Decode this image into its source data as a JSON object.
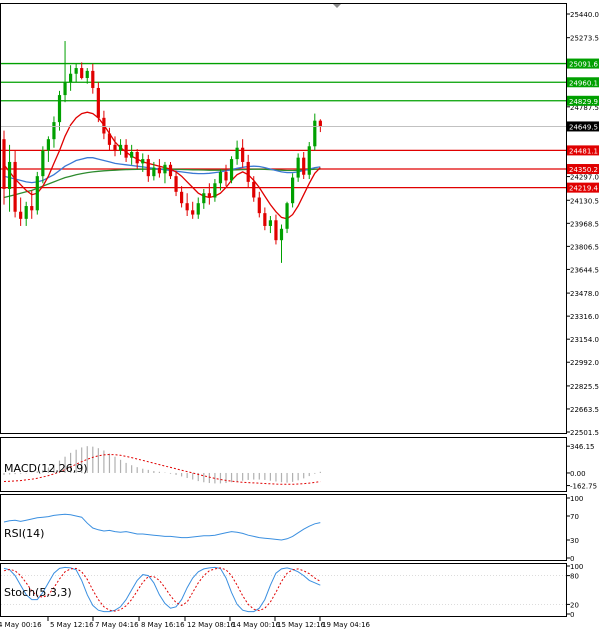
{
  "chart_data": {
    "type": "candlestick",
    "panels": {
      "main": {
        "y_ticks": [
          "25440.0",
          "25273.5",
          "24787.5",
          "24297.0",
          "24130.5",
          "23968.5",
          "23806.5",
          "23644.5",
          "23478.0",
          "23316.0",
          "23154.0",
          "22992.0",
          "22825.5",
          "22663.5",
          "22501.5"
        ],
        "ylim": [
          22501.5,
          25440.0
        ],
        "candles": [
          {
            "o": 24560,
            "h": 24620,
            "l": 24100,
            "c": 24210
          },
          {
            "o": 24210,
            "h": 24520,
            "l": 24050,
            "c": 24400
          },
          {
            "o": 24400,
            "h": 24480,
            "l": 24010,
            "c": 24050
          },
          {
            "o": 24050,
            "h": 24150,
            "l": 23950,
            "c": 24000
          },
          {
            "o": 24000,
            "h": 24120,
            "l": 23950,
            "c": 24090
          },
          {
            "o": 24090,
            "h": 24200,
            "l": 24000,
            "c": 24060
          },
          {
            "o": 24060,
            "h": 24330,
            "l": 24030,
            "c": 24300
          },
          {
            "o": 24300,
            "h": 24510,
            "l": 24250,
            "c": 24480
          },
          {
            "o": 24480,
            "h": 24580,
            "l": 24400,
            "c": 24560
          },
          {
            "o": 24560,
            "h": 24720,
            "l": 24500,
            "c": 24680
          },
          {
            "o": 24680,
            "h": 24900,
            "l": 24620,
            "c": 24870
          },
          {
            "o": 24870,
            "h": 25250,
            "l": 24820,
            "c": 24960
          },
          {
            "o": 24960,
            "h": 25080,
            "l": 24900,
            "c": 25020
          },
          {
            "o": 25020,
            "h": 25090,
            "l": 24960,
            "c": 25060
          },
          {
            "o": 25060,
            "h": 25100,
            "l": 24980,
            "c": 24990
          },
          {
            "o": 24990,
            "h": 25060,
            "l": 24950,
            "c": 25040
          },
          {
            "o": 25040,
            "h": 25090,
            "l": 24880,
            "c": 24920
          },
          {
            "o": 24920,
            "h": 24960,
            "l": 24680,
            "c": 24710
          },
          {
            "o": 24710,
            "h": 24760,
            "l": 24560,
            "c": 24600
          },
          {
            "o": 24600,
            "h": 24640,
            "l": 24480,
            "c": 24520
          },
          {
            "o": 24520,
            "h": 24580,
            "l": 24440,
            "c": 24480
          },
          {
            "o": 24480,
            "h": 24560,
            "l": 24450,
            "c": 24520
          },
          {
            "o": 24520,
            "h": 24560,
            "l": 24400,
            "c": 24430
          },
          {
            "o": 24430,
            "h": 24520,
            "l": 24380,
            "c": 24470
          },
          {
            "o": 24470,
            "h": 24490,
            "l": 24350,
            "c": 24390
          },
          {
            "o": 24390,
            "h": 24460,
            "l": 24330,
            "c": 24420
          },
          {
            "o": 24420,
            "h": 24450,
            "l": 24260,
            "c": 24300
          },
          {
            "o": 24300,
            "h": 24400,
            "l": 24270,
            "c": 24360
          },
          {
            "o": 24360,
            "h": 24420,
            "l": 24290,
            "c": 24320
          },
          {
            "o": 24320,
            "h": 24400,
            "l": 24250,
            "c": 24380
          },
          {
            "o": 24380,
            "h": 24400,
            "l": 24280,
            "c": 24300
          },
          {
            "o": 24300,
            "h": 24340,
            "l": 24160,
            "c": 24190
          },
          {
            "o": 24190,
            "h": 24230,
            "l": 24080,
            "c": 24110
          },
          {
            "o": 24110,
            "h": 24180,
            "l": 24020,
            "c": 24060
          },
          {
            "o": 24060,
            "h": 24120,
            "l": 24000,
            "c": 24030
          },
          {
            "o": 24030,
            "h": 24150,
            "l": 24000,
            "c": 24110
          },
          {
            "o": 24110,
            "h": 24210,
            "l": 24070,
            "c": 24180
          },
          {
            "o": 24180,
            "h": 24250,
            "l": 24100,
            "c": 24150
          },
          {
            "o": 24150,
            "h": 24280,
            "l": 24120,
            "c": 24250
          },
          {
            "o": 24250,
            "h": 24350,
            "l": 24200,
            "c": 24330
          },
          {
            "o": 24330,
            "h": 24380,
            "l": 24230,
            "c": 24270
          },
          {
            "o": 24270,
            "h": 24440,
            "l": 24250,
            "c": 24420
          },
          {
            "o": 24420,
            "h": 24550,
            "l": 24380,
            "c": 24500
          },
          {
            "o": 24500,
            "h": 24560,
            "l": 24360,
            "c": 24400
          },
          {
            "o": 24400,
            "h": 24450,
            "l": 24220,
            "c": 24260
          },
          {
            "o": 24260,
            "h": 24300,
            "l": 24120,
            "c": 24150
          },
          {
            "o": 24150,
            "h": 24190,
            "l": 24010,
            "c": 24040
          },
          {
            "o": 24040,
            "h": 24080,
            "l": 23920,
            "c": 23950
          },
          {
            "o": 23950,
            "h": 24020,
            "l": 23900,
            "c": 23990
          },
          {
            "o": 23990,
            "h": 24030,
            "l": 23820,
            "c": 23850
          },
          {
            "o": 23850,
            "h": 23960,
            "l": 23690,
            "c": 23930
          },
          {
            "o": 23930,
            "h": 24120,
            "l": 23900,
            "c": 24110
          },
          {
            "o": 24110,
            "h": 24320,
            "l": 24080,
            "c": 24290
          },
          {
            "o": 24290,
            "h": 24460,
            "l": 24260,
            "c": 24430
          },
          {
            "o": 24430,
            "h": 24470,
            "l": 24280,
            "c": 24310
          },
          {
            "o": 24310,
            "h": 24540,
            "l": 24280,
            "c": 24510
          },
          {
            "o": 24510,
            "h": 24740,
            "l": 24480,
            "c": 24690
          },
          {
            "o": 24690,
            "h": 24700,
            "l": 24610,
            "c": 24650
          }
        ],
        "ma_fast": [
          24380,
          24330,
          24280,
          24240,
          24200,
          24170,
          24180,
          24230,
          24300,
          24390,
          24480,
          24580,
          24660,
          24710,
          24740,
          24750,
          24740,
          24710,
          24660,
          24600,
          24540,
          24500,
          24470,
          24440,
          24420,
          24400,
          24390,
          24380,
          24370,
          24360,
          24350,
          24330,
          24300,
          24260,
          24220,
          24180,
          24160,
          24150,
          24160,
          24180,
          24220,
          24270,
          24310,
          24330,
          24310,
          24270,
          24220,
          24160,
          24100,
          24050,
          24010,
          24000,
          24030,
          24090,
          24170,
          24250,
          24320,
          24360
        ],
        "ma_mid": [
          24300,
          24290,
          24280,
          24270,
          24260,
          24255,
          24260,
          24270,
          24290,
          24310,
          24340,
          24370,
          24390,
          24410,
          24420,
          24430,
          24430,
          24420,
          24410,
          24400,
          24390,
          24385,
          24380,
          24375,
          24370,
          24365,
          24360,
          24355,
          24350,
          24345,
          24340,
          24335,
          24330,
          24325,
          24320,
          24318,
          24318,
          24320,
          24325,
          24330,
          24338,
          24346,
          24355,
          24362,
          24368,
          24370,
          24368,
          24360,
          24350,
          24340,
          24330,
          24325,
          24325,
          24330,
          24340,
          24350,
          24360,
          24365
        ],
        "ma_slow": [
          24150,
          24160,
          24170,
          24180,
          24190,
          24200,
          24215,
          24230,
          24245,
          24260,
          24275,
          24290,
          24300,
          24310,
          24318,
          24325,
          24330,
          24334,
          24338,
          24340,
          24342,
          24344,
          24346,
          24347,
          24348,
          24349,
          24350,
          24350,
          24350,
          24350,
          24349,
          24348,
          24347,
          24346,
          24345,
          24344,
          24343,
          24342,
          24342,
          24342,
          24342,
          24343,
          24344,
          24346,
          24348,
          24349,
          24349,
          24348,
          24346,
          24344,
          24342,
          24340,
          24340,
          24341,
          24343,
          24346,
          24349,
          24350
        ],
        "price_lines": [
          {
            "value": "25091.6",
            "color": "#00a000"
          },
          {
            "value": "24960.1",
            "color": "#00a000"
          },
          {
            "value": "24829.9",
            "color": "#00a000"
          },
          {
            "value": "24481.1",
            "color": "#e00000"
          },
          {
            "value": "24350.2",
            "color": "#e00000"
          },
          {
            "value": "24219.4",
            "color": "#e00000"
          }
        ],
        "current_price": "24649.5"
      },
      "macd": {
        "label": "MACD(12,26,9)",
        "y_ticks": [
          "346.15",
          "0.00",
          "-162.75"
        ],
        "ylim": [
          -220,
          400
        ],
        "histogram": [
          -25,
          -20,
          -15,
          -10,
          -5,
          5,
          20,
          40,
          70,
          110,
          160,
          210,
          260,
          300,
          330,
          346,
          340,
          320,
          290,
          250,
          210,
          170,
          130,
          100,
          75,
          55,
          40,
          25,
          15,
          5,
          -10,
          -25,
          -45,
          -65,
          -85,
          -105,
          -120,
          -130,
          -135,
          -135,
          -130,
          -120,
          -110,
          -100,
          -90,
          -85,
          -85,
          -90,
          -100,
          -110,
          -120,
          -125,
          -115,
          -95,
          -70,
          -40,
          -10,
          15
        ],
        "signal": [
          -110,
          -108,
          -104,
          -98,
          -90,
          -80,
          -68,
          -52,
          -34,
          -12,
          14,
          44,
          78,
          112,
          146,
          176,
          202,
          222,
          234,
          238,
          236,
          228,
          214,
          198,
          180,
          162,
          144,
          126,
          108,
          90,
          72,
          54,
          36,
          18,
          0,
          -18,
          -36,
          -54,
          -70,
          -84,
          -96,
          -106,
          -114,
          -120,
          -124,
          -128,
          -132,
          -136,
          -140,
          -144,
          -146,
          -147,
          -146,
          -143,
          -138,
          -131,
          -122,
          -112
        ]
      },
      "rsi": {
        "label": "RSI(14)",
        "y_ticks": [
          "100",
          "70",
          "30",
          "0"
        ],
        "ylim": [
          0,
          100
        ],
        "values": [
          60,
          62,
          63,
          61,
          63,
          65,
          67,
          68,
          69,
          71,
          72,
          73,
          72,
          70,
          68,
          58,
          50,
          47,
          45,
          46,
          44,
          43,
          44,
          42,
          40,
          40,
          39,
          38,
          37,
          36,
          36,
          35,
          34,
          34,
          35,
          36,
          37,
          37,
          38,
          40,
          42,
          44,
          43,
          41,
          38,
          36,
          34,
          33,
          32,
          31,
          30,
          32,
          36,
          42,
          48,
          53,
          57,
          59
        ]
      },
      "stoch": {
        "label": "Stoch(5,3,3)",
        "y_ticks": [
          "100",
          "80",
          "20",
          "0"
        ],
        "ylim": [
          0,
          100
        ],
        "k": [
          95,
          92,
          80,
          60,
          40,
          30,
          30,
          45,
          65,
          85,
          95,
          97,
          96,
          92,
          70,
          40,
          18,
          8,
          5,
          5,
          8,
          15,
          30,
          50,
          70,
          82,
          80,
          65,
          40,
          22,
          12,
          15,
          30,
          55,
          75,
          88,
          94,
          96,
          97,
          95,
          75,
          45,
          20,
          8,
          5,
          5,
          12,
          30,
          60,
          85,
          94,
          96,
          93,
          88,
          80,
          70,
          65,
          60
        ],
        "d": [
          90,
          93,
          90,
          80,
          65,
          48,
          38,
          35,
          40,
          55,
          73,
          88,
          94,
          95,
          88,
          72,
          50,
          30,
          15,
          8,
          6,
          9,
          17,
          30,
          48,
          66,
          78,
          78,
          70,
          55,
          38,
          24,
          18,
          25,
          45,
          65,
          80,
          90,
          94,
          96,
          92,
          80,
          60,
          38,
          20,
          10,
          7,
          12,
          25,
          45,
          68,
          85,
          92,
          94,
          90,
          84,
          75,
          68
        ]
      }
    },
    "x_labels": [
      "4 May 00:16",
      "5 May 12:16",
      "7 May 04:16",
      "8 May 16:16",
      "12 May 08:16",
      "14 May 00:16",
      "15 May 12:16",
      "19 May 04:16"
    ]
  },
  "colors": {
    "up_candle": "#00a000",
    "down_candle": "#e00000",
    "ma_fast": "#e00000",
    "ma_mid": "#3a78d4",
    "ma_slow": "#2e8b2e",
    "macd_hist": "#b0b0b0",
    "macd_signal": "#e00000",
    "rsi_line": "#3a8fe0",
    "stoch_k": "#3a8fe0",
    "stoch_d": "#e00000"
  }
}
